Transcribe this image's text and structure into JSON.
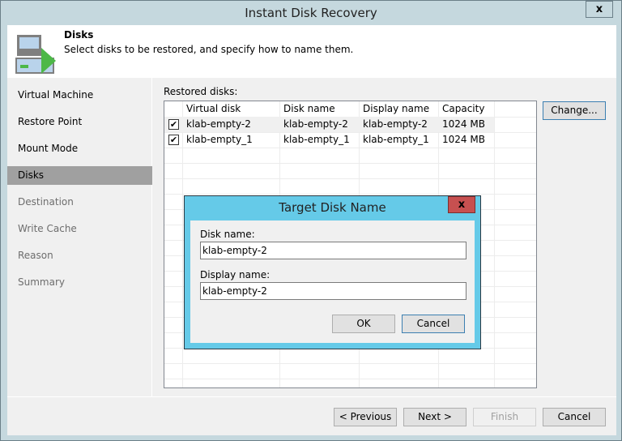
{
  "window": {
    "title": "Instant Disk Recovery",
    "close_glyph": "x"
  },
  "header": {
    "title": "Disks",
    "subtitle": "Select disks to be restored, and specify how to name them.",
    "icon": "disk-restore-icon"
  },
  "sidebar": {
    "items": [
      {
        "label": "Virtual Machine",
        "state": "done"
      },
      {
        "label": "Restore Point",
        "state": "done"
      },
      {
        "label": "Mount Mode",
        "state": "done"
      },
      {
        "label": "Disks",
        "state": "active"
      },
      {
        "label": "Destination",
        "state": "disabled"
      },
      {
        "label": "Write Cache",
        "state": "disabled"
      },
      {
        "label": "Reason",
        "state": "disabled"
      },
      {
        "label": "Summary",
        "state": "disabled"
      }
    ]
  },
  "main": {
    "restored_label": "Restored disks:",
    "change_button": "Change...",
    "columns": [
      "Virtual disk",
      "Disk name",
      "Display name",
      "Capacity"
    ],
    "rows": [
      {
        "checked": true,
        "virtual_disk": "klab-empty-2",
        "disk_name": "klab-empty-2",
        "display_name": "klab-empty-2",
        "capacity": "1024 MB",
        "selected": true
      },
      {
        "checked": true,
        "virtual_disk": "klab-empty_1",
        "disk_name": "klab-empty_1",
        "display_name": "klab-empty_1",
        "capacity": "1024 MB",
        "selected": false
      }
    ],
    "check_glyph": "✔"
  },
  "dialog": {
    "title": "Target Disk Name",
    "close_glyph": "x",
    "disk_name_label": "Disk name:",
    "disk_name_value": "klab-empty-2",
    "display_name_label": "Display name:",
    "display_name_value": "klab-empty-2",
    "ok": "OK",
    "cancel": "Cancel"
  },
  "footer": {
    "previous": "< Previous",
    "next": "Next >",
    "finish": "Finish",
    "cancel": "Cancel"
  }
}
